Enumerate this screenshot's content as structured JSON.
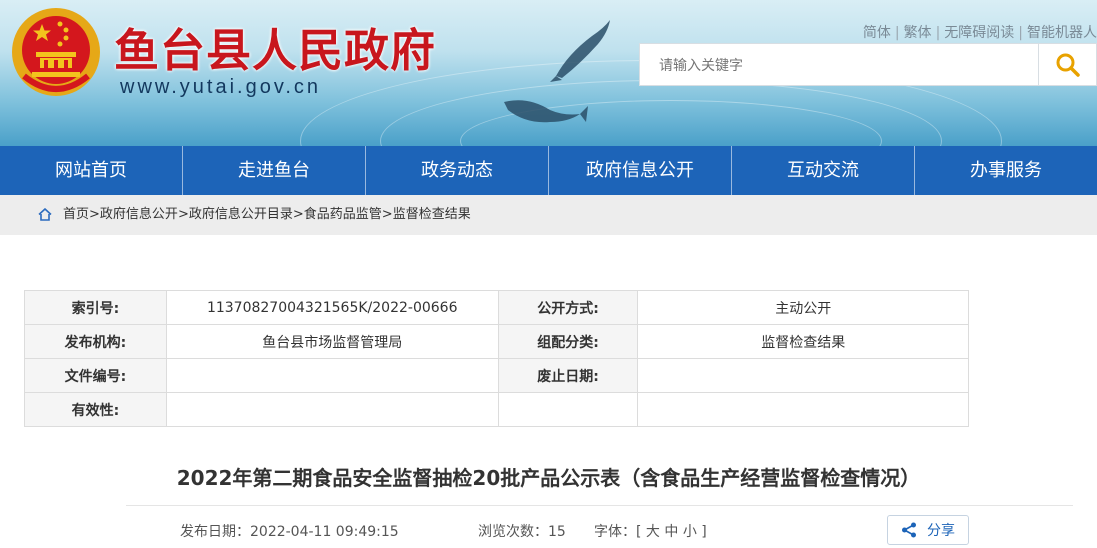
{
  "header": {
    "site_title": "鱼台县人民政府",
    "site_url": "www.yutai.gov.cn",
    "top_links": [
      "简体",
      "繁体",
      "无障碍阅读",
      "智能机器人"
    ],
    "search_placeholder": "请输入关键字"
  },
  "nav": {
    "items": [
      "网站首页",
      "走进鱼台",
      "政务动态",
      "政府信息公开",
      "互动交流",
      "办事服务"
    ]
  },
  "breadcrumb": {
    "items": [
      "首页",
      "政府信息公开",
      "政府信息公开目录",
      "食品药品监管",
      "监督检查结果"
    ],
    "separator": ">"
  },
  "meta": {
    "index_no_label": "索引号:",
    "index_no": "11370827004321565K/2022-00666",
    "disclosure_label": "公开方式:",
    "disclosure": "主动公开",
    "publisher_label": "发布机构:",
    "publisher": "鱼台县市场监督管理局",
    "category_label": "组配分类:",
    "category": "监督检查结果",
    "doc_no_label": "文件编号:",
    "doc_no": "",
    "expiry_label": "废止日期:",
    "expiry": "",
    "validity_label": "有效性:",
    "validity": ""
  },
  "article": {
    "title": "2022年第二期食品安全监督抽检20批产品公示表（含食品生产经营监督检查情况）",
    "publish_date": "发布日期：2022-04-11 09:49:15",
    "views": "浏览次数：15",
    "font_label": "字体：[",
    "font_large": "大",
    "font_medium": "中",
    "font_small": "小",
    "font_end": "]",
    "share_label": "分享"
  },
  "colors": {
    "nav_bg": "#1d64b8",
    "title_red": "#c8161d",
    "breadcrumb_bg": "#ededed"
  }
}
